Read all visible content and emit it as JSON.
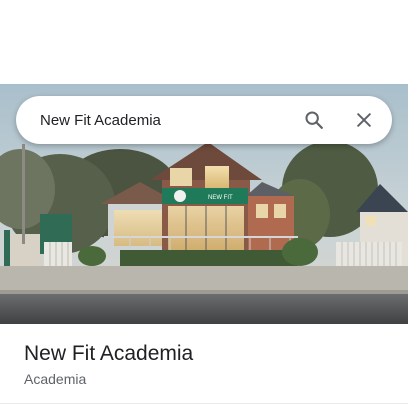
{
  "search": {
    "query": "New Fit Academia"
  },
  "photo": {
    "sign_text": "NEW FIT"
  },
  "place": {
    "name": "New Fit Academia",
    "category": "Academia"
  },
  "icons": {
    "search": "search-icon",
    "close": "close-icon"
  },
  "colors": {
    "brand_green": "#1f7a5a",
    "text_primary": "#202124",
    "text_secondary": "#5f6368",
    "icon_gray": "#5f6368"
  }
}
